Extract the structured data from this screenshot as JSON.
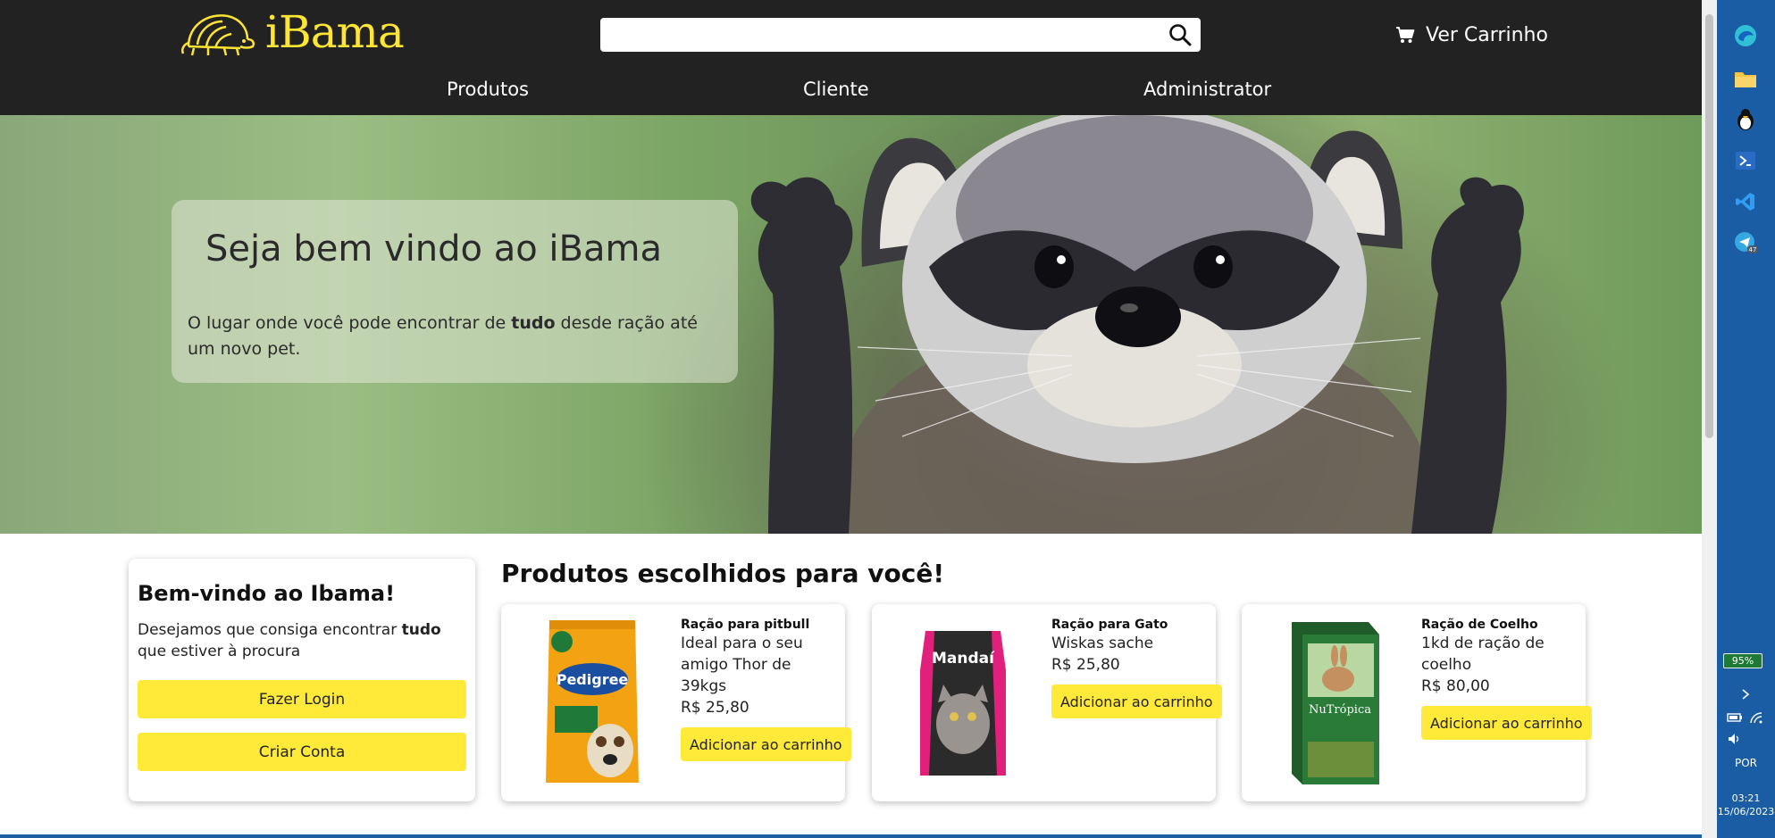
{
  "header": {
    "logo_text": "iBama",
    "search": {
      "value": "",
      "placeholder": ""
    },
    "cart_label": "Ver Carrinho"
  },
  "nav": {
    "items": [
      "Produtos",
      "Cliente",
      "Administrator"
    ]
  },
  "hero": {
    "title": "Seja bem vindo ao iBama",
    "text_before": "O lugar onde você pode encontrar de ",
    "text_bold": "tudo",
    "text_after": " desde ração até um novo pet."
  },
  "welcome": {
    "title": "Bem-vindo ao Ibama!",
    "text_before": "Desejamos que consiga encontrar ",
    "text_bold": "tudo",
    "text_after": " que estiver à procura",
    "login_label": "Fazer Login",
    "signup_label": "Criar Conta"
  },
  "products": {
    "title": "Produtos escolhidos para você!",
    "add_label": "Adicionar ao carrinho",
    "items": [
      {
        "name": "Ração para pitbull",
        "desc": "Ideal para o seu amigo Thor de 39kgs",
        "price": "R$ 25,80",
        "brand": "Pedigree",
        "color": "#f3a312"
      },
      {
        "name": "Ração para Gato",
        "desc": "Wiskas sache",
        "price": "R$ 25,80",
        "brand": "Mandaí",
        "color": "#2b2b2b"
      },
      {
        "name": "Ração de Coelho",
        "desc": "1kd de ração de coelho",
        "price": "R$ 80,00",
        "brand": "NuTrópica",
        "color": "#1f5c2a"
      }
    ]
  },
  "taskbar": {
    "battery": "95%",
    "language": "POR",
    "time": "03:21",
    "date": "15/06/2023",
    "notification_count": "47"
  },
  "colors": {
    "header_bg": "#222222",
    "accent_yellow": "#ffea3a",
    "taskbar_bg": "#1a5da5"
  }
}
